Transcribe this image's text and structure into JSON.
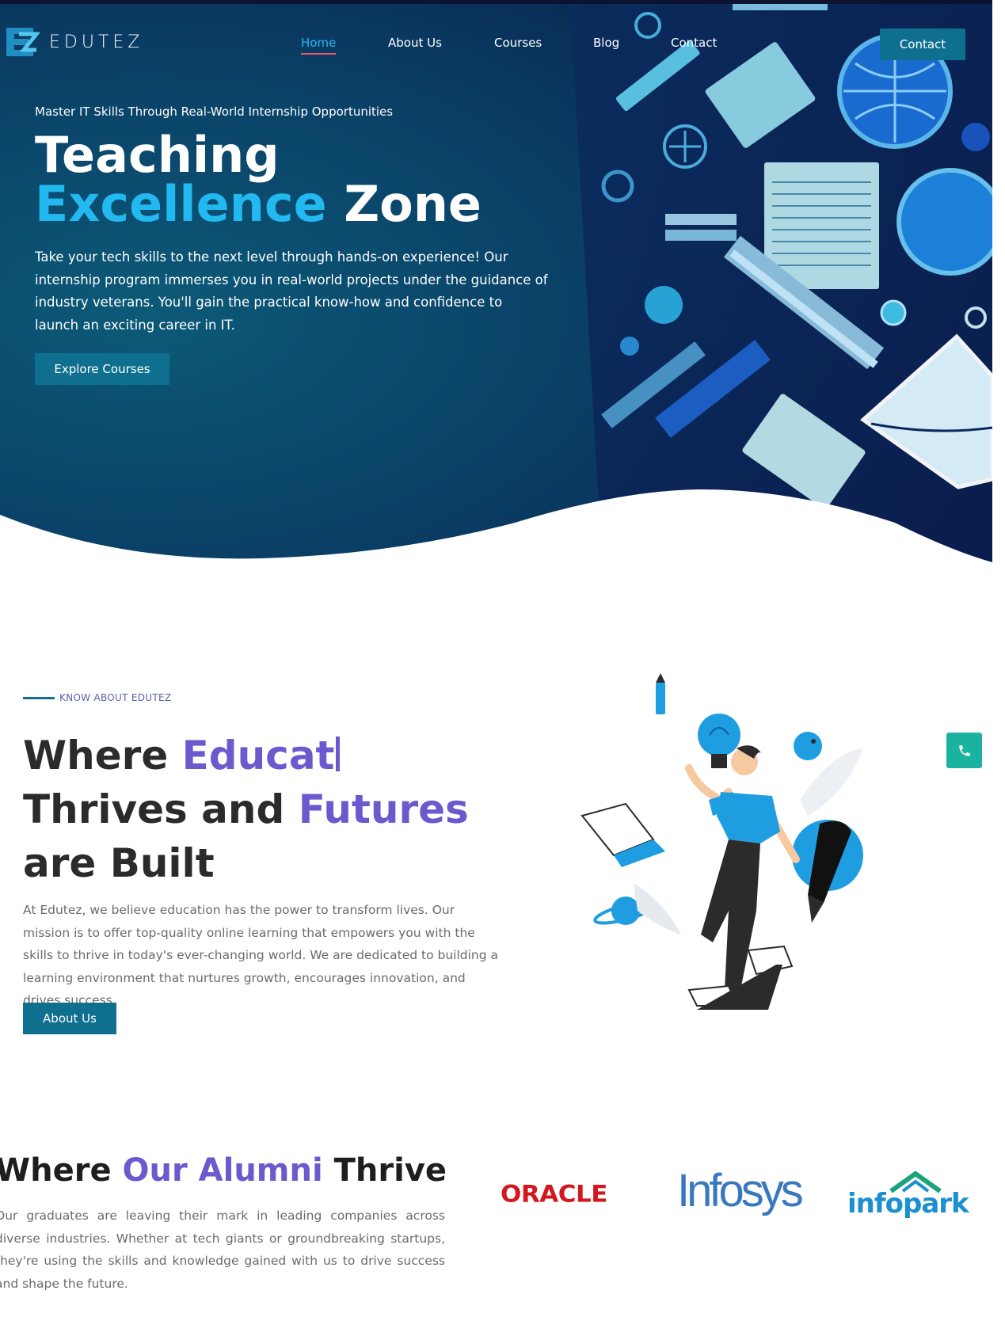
{
  "brand": {
    "name": "EDUTEZ",
    "logo_mark": "EZ"
  },
  "nav": {
    "items": [
      {
        "label": "Home",
        "active": true
      },
      {
        "label": "About Us",
        "active": false
      },
      {
        "label": "Courses",
        "active": false
      },
      {
        "label": "Blog",
        "active": false
      },
      {
        "label": "Contact",
        "active": false
      }
    ],
    "cta_label": "Contact"
  },
  "hero": {
    "eyebrow": "Master IT Skills Through Real-World Internship Opportunities",
    "title_line1": "Teaching",
    "title_accent": "Excellence",
    "title_rest": " Zone",
    "description": "Take your tech skills to the next level through hands-on experience! Our internship program immerses you in real-world projects under the guidance of industry veterans. You'll gain the practical know-how and confidence to launch an exciting career in IT.",
    "button_label": "Explore Courses"
  },
  "about": {
    "eyebrow": "KNOW ABOUT EDUTEZ",
    "title_part1": "Where ",
    "title_typed": "Educat",
    "title_part2": "Thrives and ",
    "title_accent2": "Futures",
    "title_part3": "are Built",
    "description": "At Edutez, we believe education has the power to transform lives. Our mission is to offer top-quality online learning that empowers you with the skills to thrive in today's ever-changing world. We are dedicated to building a learning environment that nurtures growth, encourages innovation, and drives success",
    "button_label": "About Us",
    "phone_icon": "phone-icon"
  },
  "alumni": {
    "title_part1": "Where ",
    "title_accent": "Our Alumni",
    "title_part2": " Thrive",
    "description": "Our graduates are leaving their mark in leading companies across diverse industries. Whether at tech giants or groundbreaking startups, they're using the skills and knowledge gained with us to drive success and shape the future.",
    "companies": [
      "ORACLE",
      "Infosys",
      "infopark"
    ]
  },
  "colors": {
    "primary_button": "#0e6f8f",
    "accent_cyan": "#22b8f0",
    "accent_purple": "#6a5acd",
    "phone_button": "#19b3a0",
    "oracle_red": "#d4161e"
  }
}
